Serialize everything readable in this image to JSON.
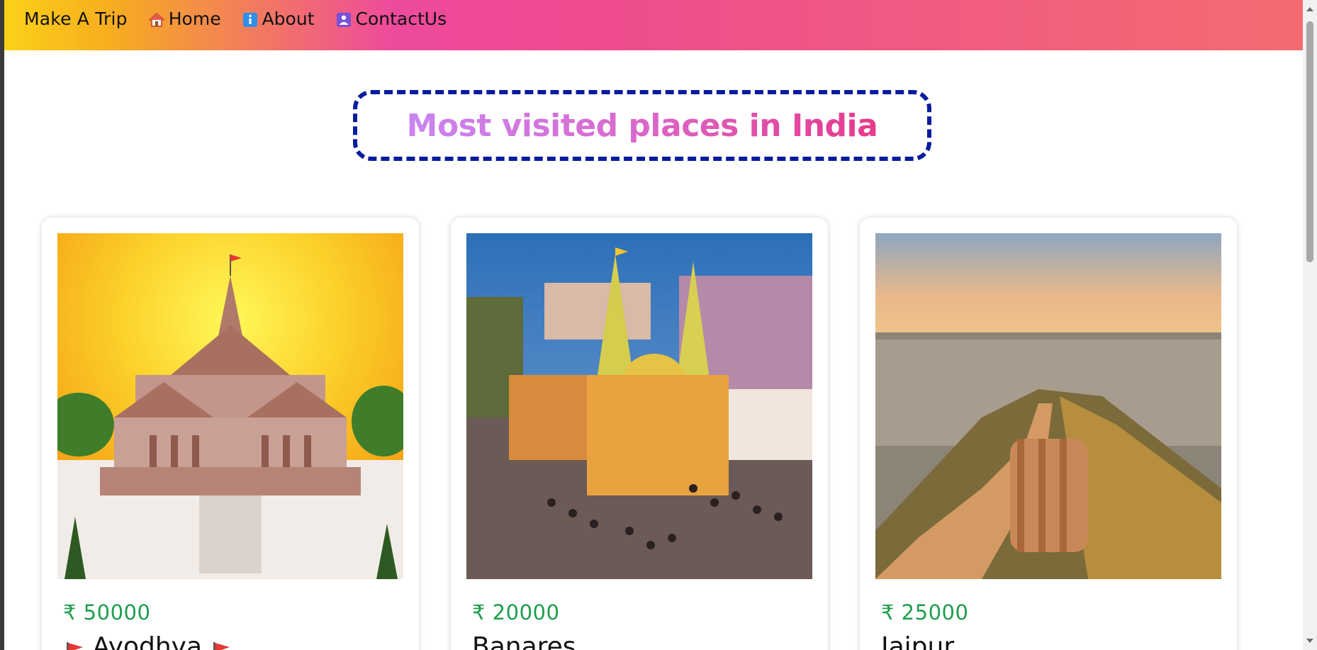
{
  "nav": {
    "brand": "Make A Trip",
    "links": [
      {
        "label": "Home",
        "icon": "house-icon"
      },
      {
        "label": "About",
        "icon": "info-icon"
      },
      {
        "label": "ContactUs",
        "icon": "contact-card-icon"
      }
    ],
    "gradient": [
      "#fbd119",
      "#ee4a9d",
      "#f56b71"
    ]
  },
  "heading": {
    "title": "Most visited places in India",
    "border_color": "#081c9e"
  },
  "cards": [
    {
      "price": "₹ 50000",
      "name": "Ayodhya",
      "flags": true,
      "image": "ram-temple-image"
    },
    {
      "price": "₹ 20000",
      "name": "Banares",
      "flags": false,
      "image": "kashi-vishwanath-image"
    },
    {
      "price": "₹ 25000",
      "name": "Jaipur",
      "flags": false,
      "image": "jaipur-fort-wall-image"
    }
  ],
  "colors": {
    "price": "#1f9e4c"
  }
}
